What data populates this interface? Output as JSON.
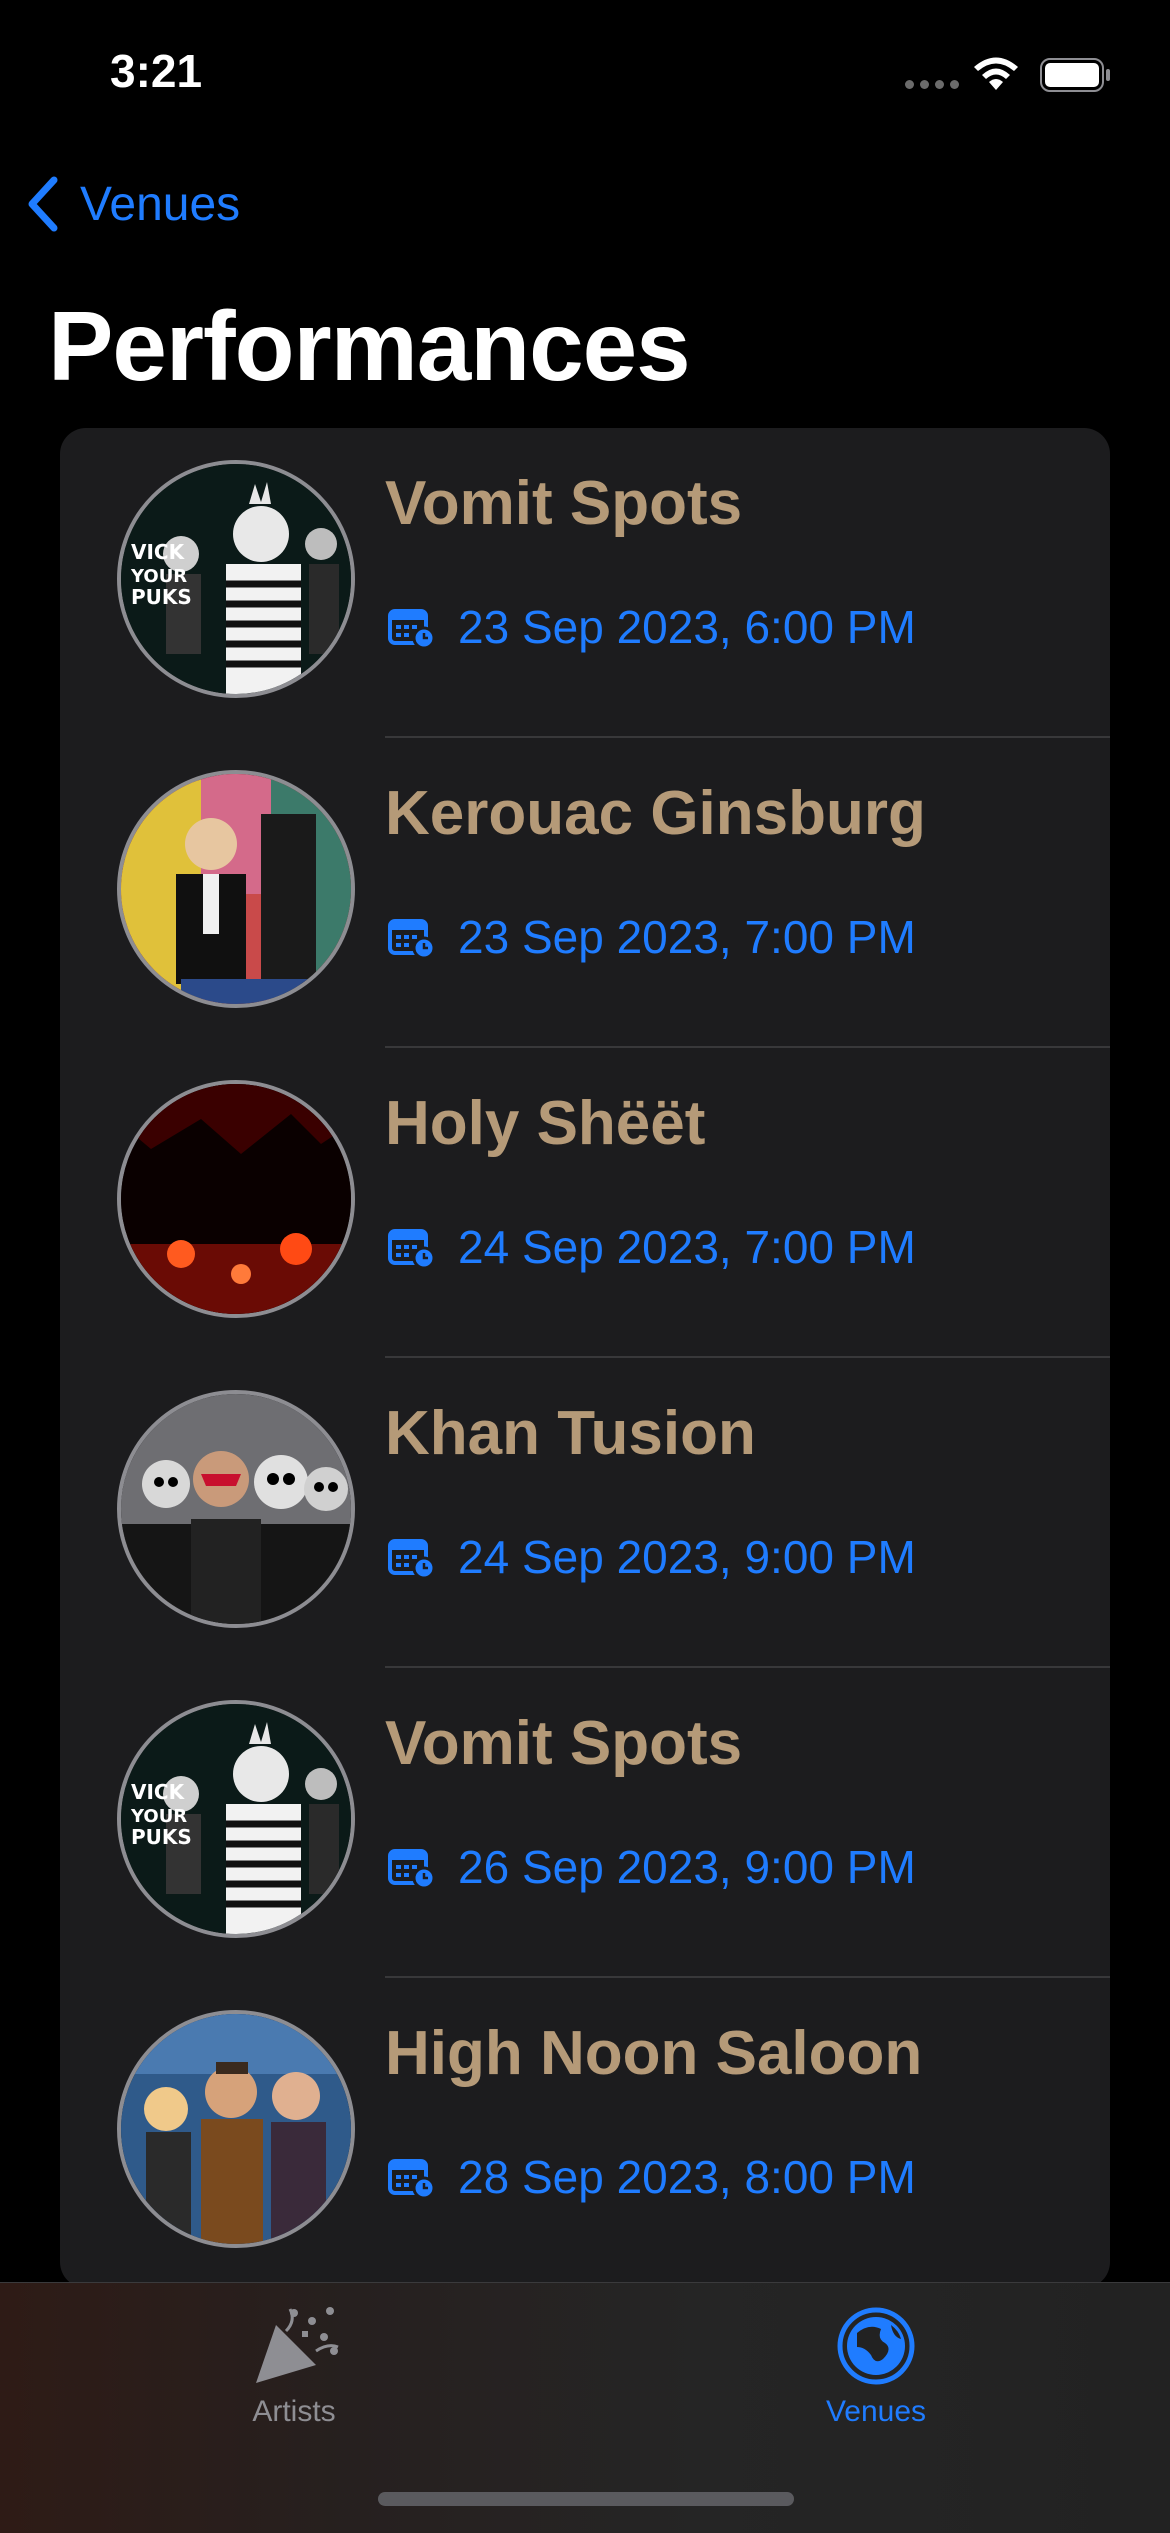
{
  "status_bar": {
    "time": "3:21"
  },
  "nav": {
    "back_label": "Venues",
    "title": "Performances"
  },
  "performances": [
    {
      "name": "Vomit Spots",
      "date": "23 Sep 2023, 6:00 PM",
      "avatar": "band-photo"
    },
    {
      "name": "Kerouac Ginsburg",
      "date": "23 Sep 2023, 7:00 PM",
      "avatar": "band-photo"
    },
    {
      "name": "Holy Shëët",
      "date": "24 Sep 2023, 7:00 PM",
      "avatar": "band-poster"
    },
    {
      "name": "Khan Tusion",
      "date": "24 Sep 2023, 9:00 PM",
      "avatar": "band-photo"
    },
    {
      "name": "Vomit Spots",
      "date": "26 Sep 2023, 9:00 PM",
      "avatar": "band-photo"
    },
    {
      "name": "High Noon Saloon",
      "date": "28 Sep 2023, 8:00 PM",
      "avatar": "band-photo"
    }
  ],
  "tabs": [
    {
      "label": "Artists",
      "icon": "party-popper-icon",
      "selected": false
    },
    {
      "label": "Venues",
      "icon": "globe-icon",
      "selected": true
    }
  ],
  "colors": {
    "accent": "#1f7cff",
    "artist_name": "#b59a78",
    "card": "#1c1c1e"
  }
}
